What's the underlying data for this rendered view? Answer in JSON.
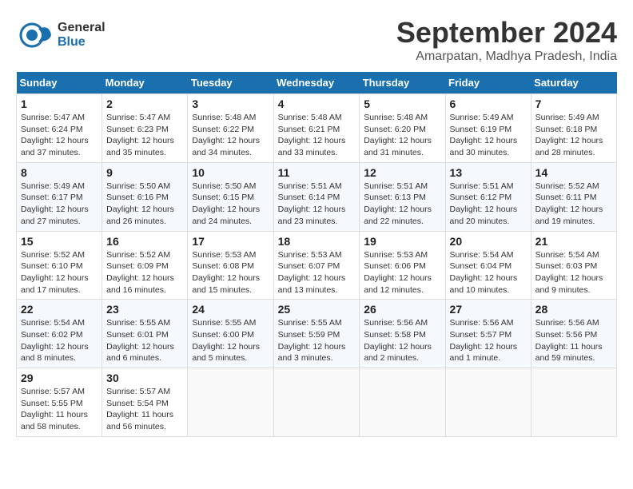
{
  "header": {
    "logo_line1": "General",
    "logo_line2": "Blue",
    "month_title": "September 2024",
    "location": "Amarpatan, Madhya Pradesh, India"
  },
  "days_of_week": [
    "Sunday",
    "Monday",
    "Tuesday",
    "Wednesday",
    "Thursday",
    "Friday",
    "Saturday"
  ],
  "weeks": [
    [
      {
        "day": "1",
        "sunrise": "5:47 AM",
        "sunset": "6:24 PM",
        "daylight": "12 hours and 37 minutes."
      },
      {
        "day": "2",
        "sunrise": "5:47 AM",
        "sunset": "6:23 PM",
        "daylight": "12 hours and 35 minutes."
      },
      {
        "day": "3",
        "sunrise": "5:48 AM",
        "sunset": "6:22 PM",
        "daylight": "12 hours and 34 minutes."
      },
      {
        "day": "4",
        "sunrise": "5:48 AM",
        "sunset": "6:21 PM",
        "daylight": "12 hours and 33 minutes."
      },
      {
        "day": "5",
        "sunrise": "5:48 AM",
        "sunset": "6:20 PM",
        "daylight": "12 hours and 31 minutes."
      },
      {
        "day": "6",
        "sunrise": "5:49 AM",
        "sunset": "6:19 PM",
        "daylight": "12 hours and 30 minutes."
      },
      {
        "day": "7",
        "sunrise": "5:49 AM",
        "sunset": "6:18 PM",
        "daylight": "12 hours and 28 minutes."
      }
    ],
    [
      {
        "day": "8",
        "sunrise": "5:49 AM",
        "sunset": "6:17 PM",
        "daylight": "12 hours and 27 minutes."
      },
      {
        "day": "9",
        "sunrise": "5:50 AM",
        "sunset": "6:16 PM",
        "daylight": "12 hours and 26 minutes."
      },
      {
        "day": "10",
        "sunrise": "5:50 AM",
        "sunset": "6:15 PM",
        "daylight": "12 hours and 24 minutes."
      },
      {
        "day": "11",
        "sunrise": "5:51 AM",
        "sunset": "6:14 PM",
        "daylight": "12 hours and 23 minutes."
      },
      {
        "day": "12",
        "sunrise": "5:51 AM",
        "sunset": "6:13 PM",
        "daylight": "12 hours and 22 minutes."
      },
      {
        "day": "13",
        "sunrise": "5:51 AM",
        "sunset": "6:12 PM",
        "daylight": "12 hours and 20 minutes."
      },
      {
        "day": "14",
        "sunrise": "5:52 AM",
        "sunset": "6:11 PM",
        "daylight": "12 hours and 19 minutes."
      }
    ],
    [
      {
        "day": "15",
        "sunrise": "5:52 AM",
        "sunset": "6:10 PM",
        "daylight": "12 hours and 17 minutes."
      },
      {
        "day": "16",
        "sunrise": "5:52 AM",
        "sunset": "6:09 PM",
        "daylight": "12 hours and 16 minutes."
      },
      {
        "day": "17",
        "sunrise": "5:53 AM",
        "sunset": "6:08 PM",
        "daylight": "12 hours and 15 minutes."
      },
      {
        "day": "18",
        "sunrise": "5:53 AM",
        "sunset": "6:07 PM",
        "daylight": "12 hours and 13 minutes."
      },
      {
        "day": "19",
        "sunrise": "5:53 AM",
        "sunset": "6:06 PM",
        "daylight": "12 hours and 12 minutes."
      },
      {
        "day": "20",
        "sunrise": "5:54 AM",
        "sunset": "6:04 PM",
        "daylight": "12 hours and 10 minutes."
      },
      {
        "day": "21",
        "sunrise": "5:54 AM",
        "sunset": "6:03 PM",
        "daylight": "12 hours and 9 minutes."
      }
    ],
    [
      {
        "day": "22",
        "sunrise": "5:54 AM",
        "sunset": "6:02 PM",
        "daylight": "12 hours and 8 minutes."
      },
      {
        "day": "23",
        "sunrise": "5:55 AM",
        "sunset": "6:01 PM",
        "daylight": "12 hours and 6 minutes."
      },
      {
        "day": "24",
        "sunrise": "5:55 AM",
        "sunset": "6:00 PM",
        "daylight": "12 hours and 5 minutes."
      },
      {
        "day": "25",
        "sunrise": "5:55 AM",
        "sunset": "5:59 PM",
        "daylight": "12 hours and 3 minutes."
      },
      {
        "day": "26",
        "sunrise": "5:56 AM",
        "sunset": "5:58 PM",
        "daylight": "12 hours and 2 minutes."
      },
      {
        "day": "27",
        "sunrise": "5:56 AM",
        "sunset": "5:57 PM",
        "daylight": "12 hours and 1 minute."
      },
      {
        "day": "28",
        "sunrise": "5:56 AM",
        "sunset": "5:56 PM",
        "daylight": "11 hours and 59 minutes."
      }
    ],
    [
      {
        "day": "29",
        "sunrise": "5:57 AM",
        "sunset": "5:55 PM",
        "daylight": "11 hours and 58 minutes."
      },
      {
        "day": "30",
        "sunrise": "5:57 AM",
        "sunset": "5:54 PM",
        "daylight": "11 hours and 56 minutes."
      },
      null,
      null,
      null,
      null,
      null
    ]
  ]
}
